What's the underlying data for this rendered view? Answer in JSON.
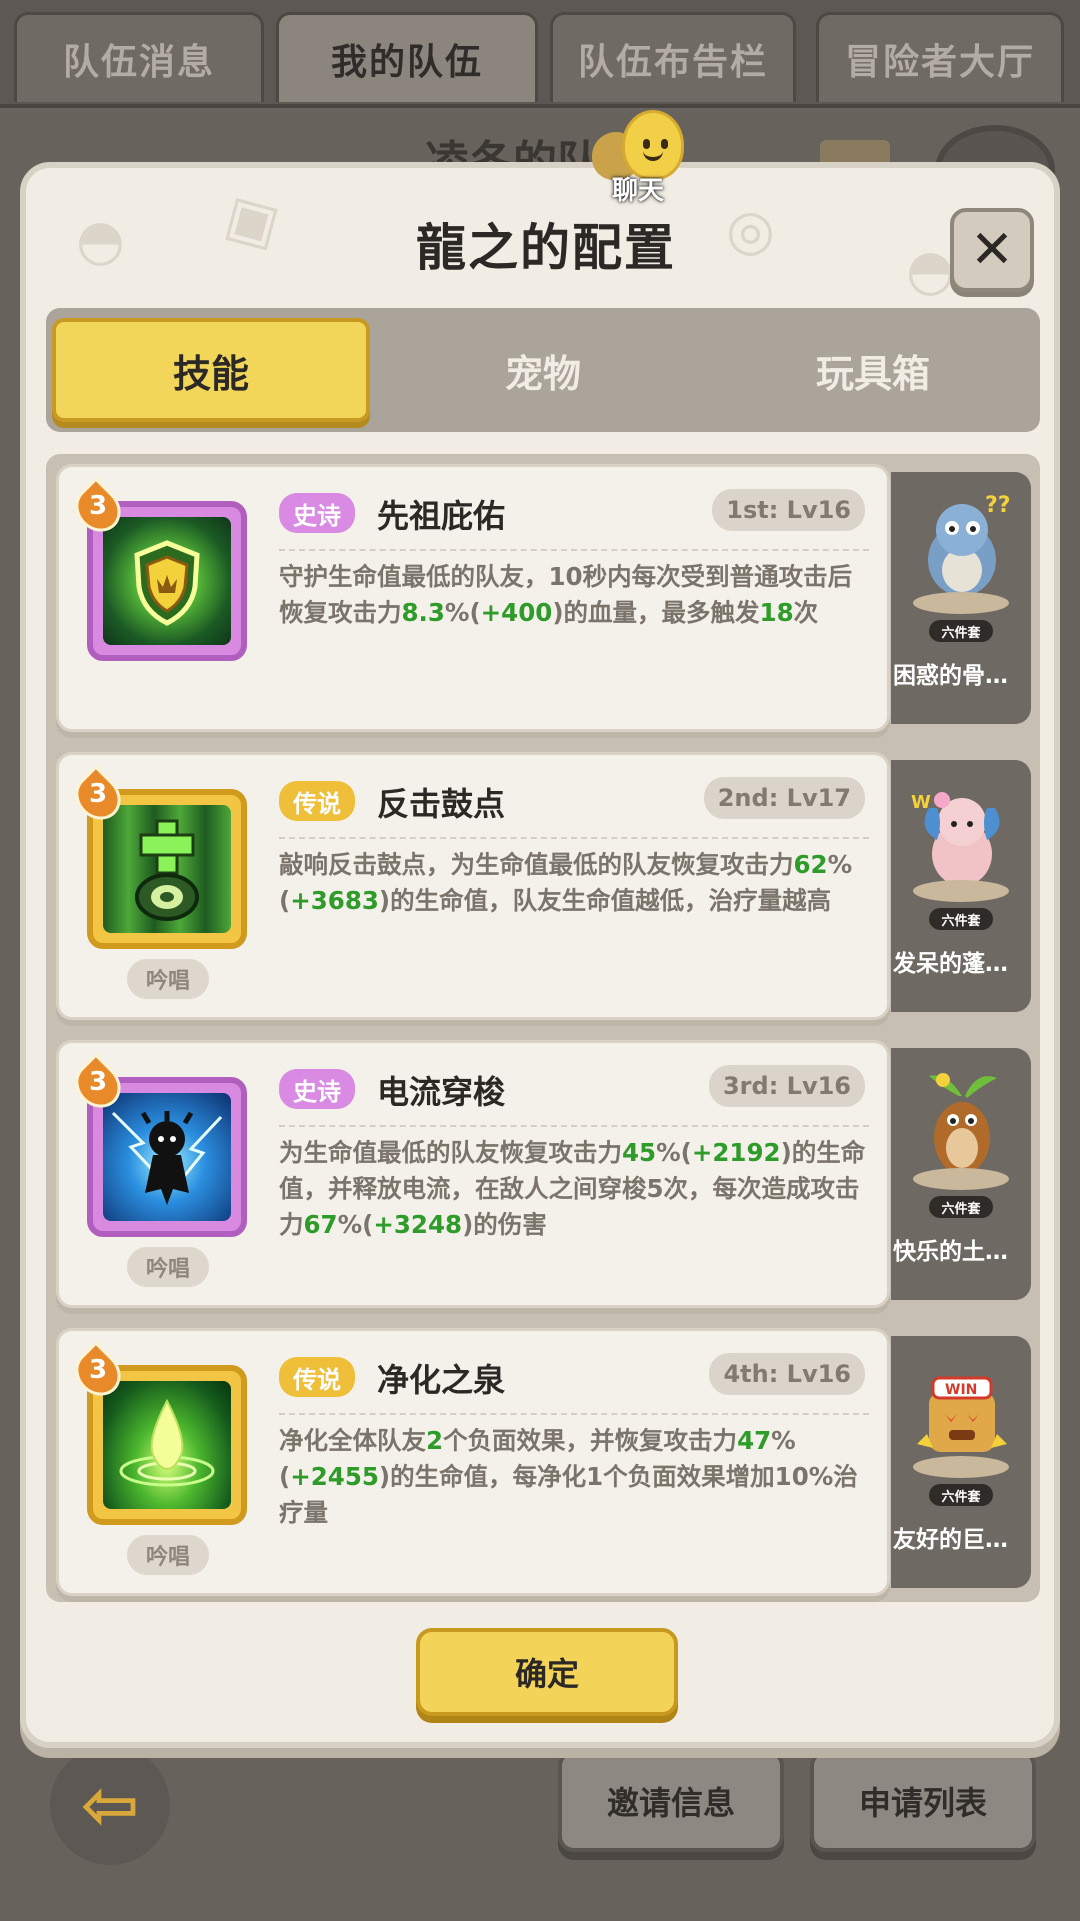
{
  "top_tabs": [
    "队伍消息",
    "我的队伍",
    "队伍布告栏",
    "冒险者大厅"
  ],
  "top_active": 1,
  "background_title": "凌冬的队",
  "chat": {
    "label": "聊天"
  },
  "modal": {
    "title": "龍之的配置",
    "close_icon": "close-icon",
    "tabs": [
      "技能",
      "宠物",
      "玩具箱"
    ],
    "active_tab": 0,
    "confirm": "确定"
  },
  "skills": [
    {
      "level": "3",
      "rarity": "史诗",
      "rarity_color": "#d98be3",
      "name": "先祖庇佑",
      "slot": "1st: Lv16",
      "chant": "",
      "desc_parts": [
        [
          "守护生命值最低的队友，10秒内每次受到普通攻击后恢复攻击力",
          false
        ],
        [
          "8.3",
          true
        ],
        [
          "%(",
          false
        ],
        [
          "+400",
          true
        ],
        [
          ")的血量，最多触发",
          false
        ],
        [
          "18",
          true
        ],
        [
          "次",
          false
        ]
      ],
      "pet_name": "困惑的骨…",
      "pet_badge": "六件套"
    },
    {
      "level": "3",
      "rarity": "传说",
      "rarity_color": "#efbf3a",
      "name": "反击鼓点",
      "slot": "2nd: Lv17",
      "chant": "吟唱",
      "desc_parts": [
        [
          "敲响反击鼓点，为生命值最低的队友恢复攻击力",
          false
        ],
        [
          "62",
          true
        ],
        [
          "%(",
          false
        ],
        [
          "+3683",
          true
        ],
        [
          ")的生命值，队友生命值越低，治疗量越高",
          false
        ]
      ],
      "pet_name": "发呆的蓬…",
      "pet_badge": "六件套"
    },
    {
      "level": "3",
      "rarity": "史诗",
      "rarity_color": "#d98be3",
      "name": "电流穿梭",
      "slot": "3rd: Lv16",
      "chant": "吟唱",
      "desc_parts": [
        [
          "为生命值最低的队友恢复攻击力",
          false
        ],
        [
          "45",
          true
        ],
        [
          "%(",
          false
        ],
        [
          "+2192",
          true
        ],
        [
          ")的生命值，并释放电流，在敌人之间穿梭5次，每次造成攻击力",
          false
        ],
        [
          "67",
          true
        ],
        [
          "%(",
          false
        ],
        [
          "+3248",
          true
        ],
        [
          ")的伤害",
          false
        ]
      ],
      "pet_name": "快乐的土…",
      "pet_badge": "六件套"
    },
    {
      "level": "3",
      "rarity": "传说",
      "rarity_color": "#efbf3a",
      "name": "净化之泉",
      "slot": "4th: Lv16",
      "chant": "吟唱",
      "desc_parts": [
        [
          "净化全体队友",
          false
        ],
        [
          "2",
          true
        ],
        [
          "个负面效果，并恢复攻击力",
          false
        ],
        [
          "47",
          true
        ],
        [
          "%(",
          false
        ],
        [
          "+2455",
          true
        ],
        [
          ")的生命值，每净化1个负面效果增加10%治疗量",
          false
        ]
      ],
      "pet_name": "友好的巨…",
      "pet_badge": "六件套"
    }
  ],
  "bottom": {
    "back_icon": "back-arrow-icon",
    "invite": "邀请信息",
    "apply": "申请列表"
  }
}
